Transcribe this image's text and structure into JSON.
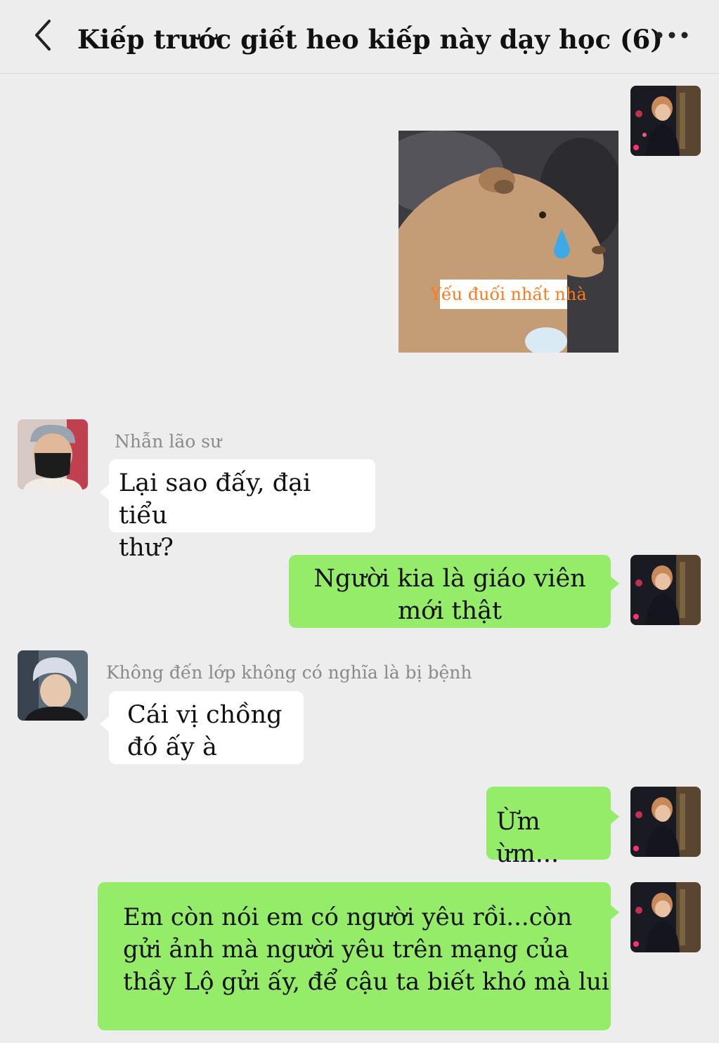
{
  "header": {
    "title": "Kiếp trước giết heo kiếp này dạy học (6)",
    "back_icon": "chevron-left-icon",
    "more_icon": "more-dots-icon"
  },
  "colors": {
    "background": "#ededed",
    "outgoing_bubble": "#95ec69",
    "incoming_bubble": "#ffffff",
    "sticker_caption": "#ff7a1a"
  },
  "messages": [
    {
      "side": "right",
      "type": "sticker",
      "caption": "Yếu đuối nhất nhà"
    },
    {
      "side": "left",
      "type": "text",
      "sender": "Nhẫn lão sư",
      "lines": [
        "Lại sao đấy, đại tiểu",
        "thư?"
      ]
    },
    {
      "side": "right",
      "type": "text",
      "lines": [
        "Người kia là giáo viên",
        "mới thật"
      ]
    },
    {
      "side": "left",
      "type": "text",
      "sender": "Không đến lớp không có nghĩa là bị bệnh",
      "lines": [
        "Cái vị chồng",
        "đó ấy à"
      ]
    },
    {
      "side": "right",
      "type": "text",
      "lines": [
        "Ừm ừm..."
      ]
    },
    {
      "side": "right",
      "type": "text",
      "lines": [
        "Em còn nói em có người yêu rồi...còn",
        "gửi ảnh mà người yêu trên mạng của",
        "thầy Lộ gửi ấy, để cậu ta biết khó mà lui"
      ]
    }
  ]
}
